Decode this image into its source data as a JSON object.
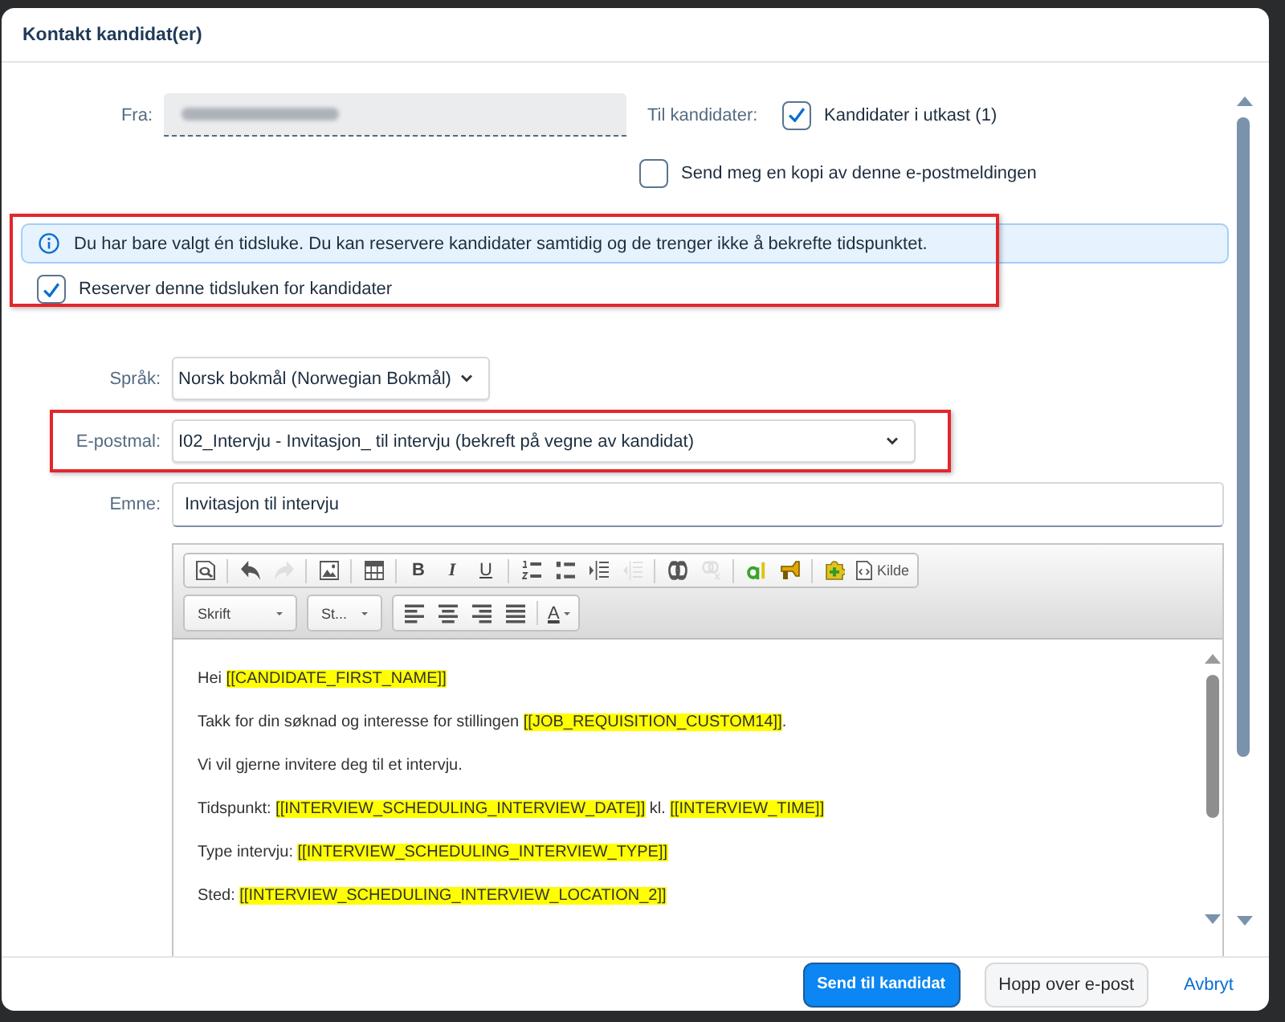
{
  "dialog": {
    "title": "Kontakt kandidat(er)"
  },
  "sender": {
    "label": "Fra:"
  },
  "recipients": {
    "label": "Til kandidater:",
    "options": [
      {
        "label": "Kandidater i utkast (1)",
        "checked": true
      },
      {
        "label": "Send meg en kopi av denne e-postmeldingen",
        "checked": false
      }
    ]
  },
  "notice": {
    "framed": true,
    "message": "Du har bare valgt én tidsluke. Du kan reservere kandidater samtidig og de trenger ikke å bekrefte tidspunktet.",
    "reserve": {
      "label": "Reserver denne tidsluken for kandidater",
      "checked": true
    }
  },
  "language": {
    "label": "Språk:",
    "value": "Norsk bokmål (Norwegian Bokmål)"
  },
  "template": {
    "label": "E-postmal:",
    "value": "I02_Intervju - Invitasjon_ til intervju (bekreft på vegne av kandidat)",
    "framed": true
  },
  "subject": {
    "label": "Emne:",
    "value": "Invitasjon til intervju"
  },
  "editor": {
    "toolbar": {
      "row_1": [
        [
          {
            "kind": "preview",
            "disabled": false
          }
        ],
        [
          {
            "kind": "undo",
            "disabled": false
          },
          {
            "kind": "redo",
            "disabled": true
          }
        ],
        [
          {
            "kind": "image",
            "disabled": false
          }
        ],
        [
          {
            "kind": "table",
            "disabled": false
          }
        ],
        [
          {
            "kind": "bold",
            "label": "B",
            "disabled": false
          },
          {
            "kind": "italic",
            "label": "I",
            "disabled": false
          },
          {
            "kind": "underline",
            "label": "U",
            "disabled": false
          }
        ],
        [
          {
            "kind": "numbered-list",
            "disabled": false
          },
          {
            "kind": "bullet-list",
            "disabled": false
          },
          {
            "kind": "indent",
            "disabled": false
          },
          {
            "kind": "outdent",
            "disabled": true
          }
        ],
        [
          {
            "kind": "link",
            "disabled": false
          },
          {
            "kind": "unlink",
            "disabled": true
          }
        ],
        [
          {
            "kind": "letter",
            "disabled": false
          },
          {
            "kind": "marker",
            "disabled": false
          }
        ],
        [
          {
            "kind": "plugin",
            "disabled": false
          },
          {
            "kind": "source",
            "label": "Kilde",
            "disabled": false
          }
        ]
      ],
      "dropdowns": [
        {
          "label": "Skrift"
        },
        {
          "label": "St..."
        }
      ],
      "row_2": [
        [
          {
            "kind": "align-left",
            "disabled": false
          },
          {
            "kind": "align-center",
            "disabled": false
          },
          {
            "kind": "align-right",
            "disabled": false
          },
          {
            "kind": "align-justify",
            "disabled": false
          }
        ],
        [
          {
            "kind": "text-color",
            "label": "A",
            "disabled": false
          }
        ]
      ]
    },
    "paragraphs": [
      {
        "parts": [
          {
            "text": "Hei ",
            "highlighted": false
          },
          {
            "text": "[[CANDIDATE_FIRST_NAME]]",
            "highlighted": true
          }
        ]
      },
      {
        "parts": [
          {
            "text": "Takk for din søknad og interesse for stillingen ",
            "highlighted": false
          },
          {
            "text": "[[JOB_REQUISITION_CUSTOM14]]",
            "highlighted": true
          },
          {
            "text": ".",
            "highlighted": false
          }
        ]
      },
      {
        "parts": [
          {
            "text": "Vi vil gjerne invitere deg til et intervju.",
            "highlighted": false
          }
        ]
      },
      {
        "parts": [
          {
            "text": "Tidspunkt: ",
            "highlighted": false
          },
          {
            "text": "[[INTERVIEW_SCHEDULING_INTERVIEW_DATE]]",
            "highlighted": true
          },
          {
            "text": " kl. ",
            "highlighted": false
          },
          {
            "text": "[[INTERVIEW_TIME]]",
            "highlighted": true
          }
        ]
      },
      {
        "parts": [
          {
            "text": "Type intervju: ",
            "highlighted": false
          },
          {
            "text": "[[INTERVIEW_SCHEDULING_INTERVIEW_TYPE]]",
            "highlighted": true
          }
        ]
      },
      {
        "parts": [
          {
            "text": "Sted: ",
            "highlighted": false
          },
          {
            "text": "[[INTERVIEW_SCHEDULING_INTERVIEW_LOCATION_2]]",
            "highlighted": true
          }
        ]
      }
    ]
  },
  "footer": {
    "buttons": [
      {
        "kind": "primary",
        "label": "Send til kandidat"
      },
      {
        "kind": "secondary",
        "label": "Hopp over e-post"
      },
      {
        "kind": "link",
        "label": "Avbryt"
      }
    ]
  }
}
